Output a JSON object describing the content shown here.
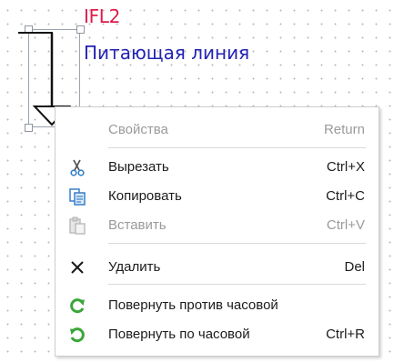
{
  "diagram": {
    "ref_label": "IFL2",
    "name_label": "Питающая линия"
  },
  "menu": {
    "items": [
      {
        "label": "Свойства",
        "shortcut": "Return",
        "enabled": false,
        "icon": "none"
      },
      {
        "label": "Вырезать",
        "shortcut": "Ctrl+X",
        "enabled": true,
        "icon": "scissors-icon"
      },
      {
        "label": "Копировать",
        "shortcut": "Ctrl+C",
        "enabled": true,
        "icon": "copy-icon"
      },
      {
        "label": "Вставить",
        "shortcut": "Ctrl+V",
        "enabled": false,
        "icon": "paste-icon"
      },
      {
        "label": "Удалить",
        "shortcut": "Del",
        "enabled": true,
        "icon": "delete-x-icon"
      },
      {
        "label": "Повернуть против часовой",
        "shortcut": "",
        "enabled": true,
        "icon": "rotate-ccw-icon"
      },
      {
        "label": "Повернуть по часовой",
        "shortcut": "Ctrl+R",
        "enabled": true,
        "icon": "rotate-cw-icon"
      }
    ]
  },
  "colors": {
    "ref_label": "#e01b4a",
    "name_label": "#2323b4",
    "rotate_icon": "#3aa63a",
    "disabled_text": "#9a9a9a"
  }
}
